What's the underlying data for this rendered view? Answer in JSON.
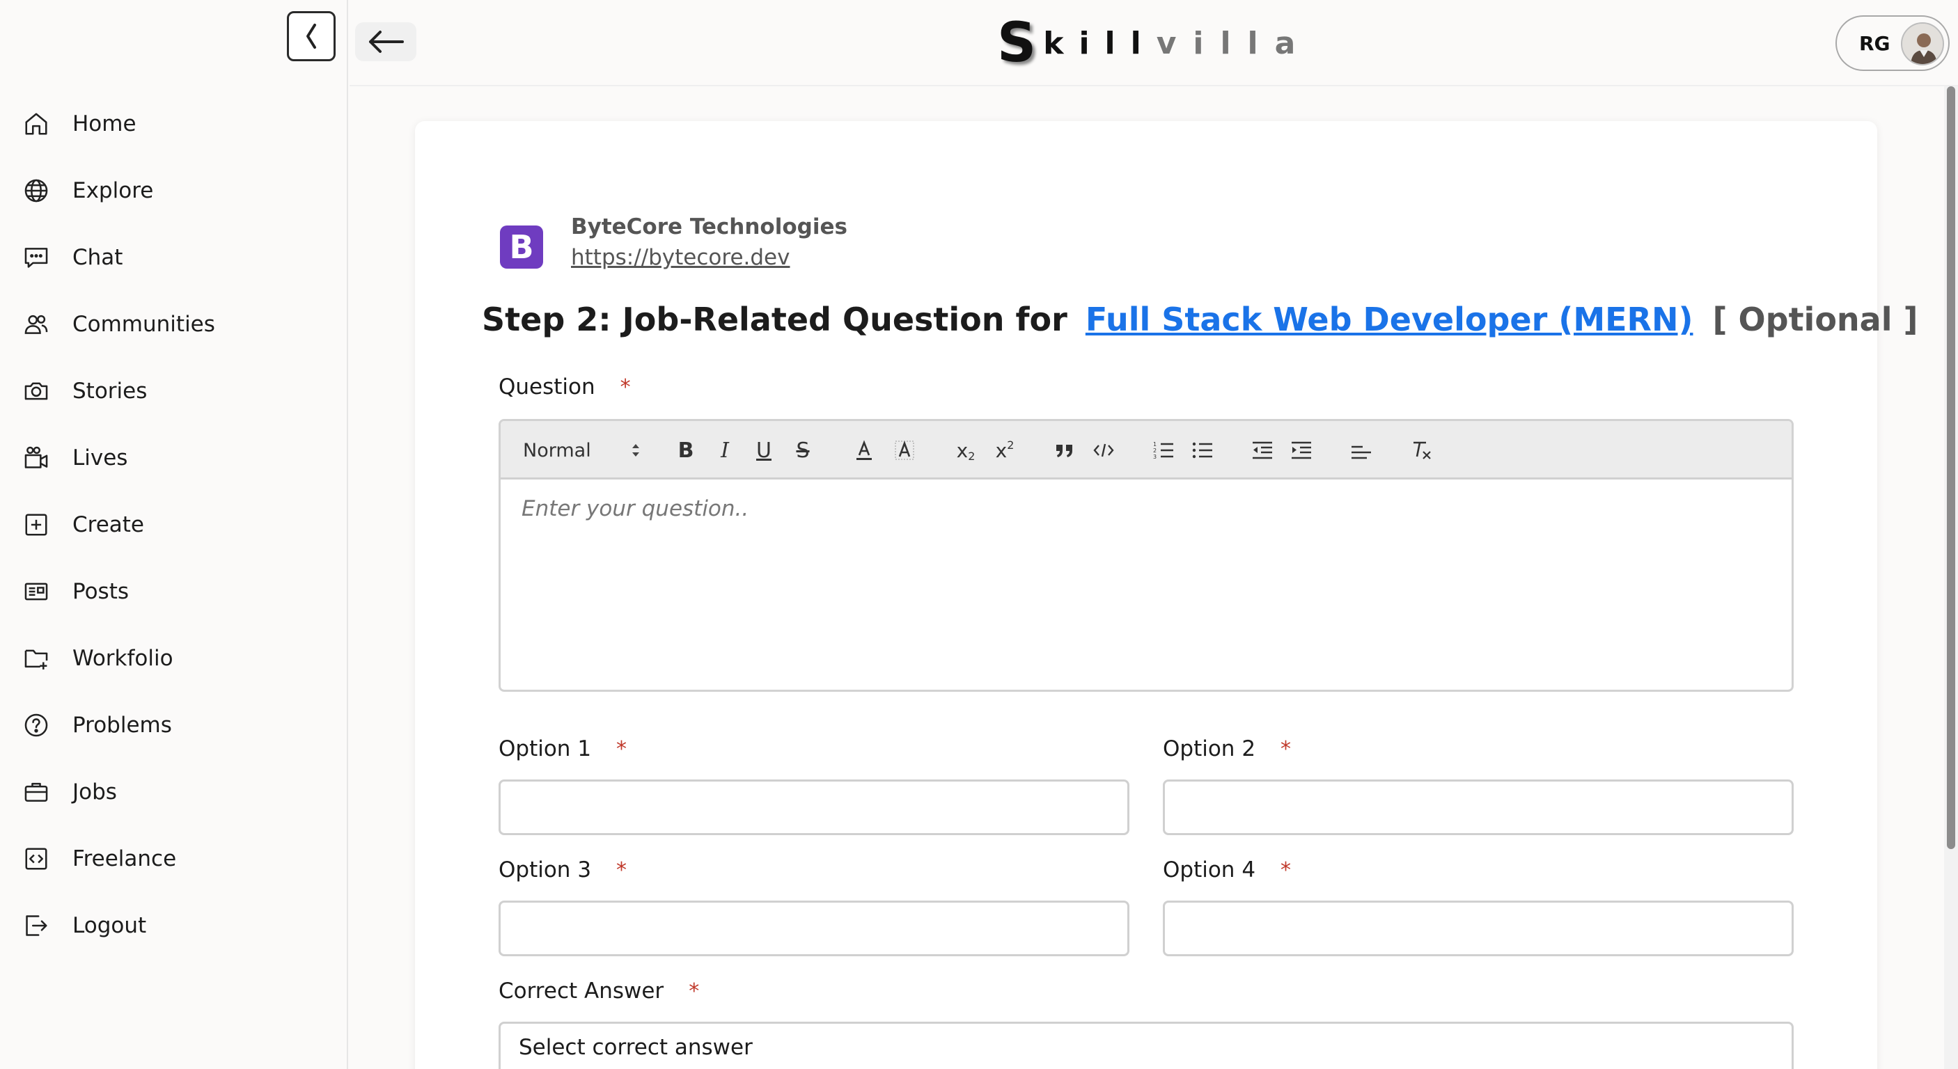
{
  "sidebar": {
    "items": [
      {
        "label": "Home",
        "icon": "home-icon"
      },
      {
        "label": "Explore",
        "icon": "globe-icon"
      },
      {
        "label": "Chat",
        "icon": "chat-icon"
      },
      {
        "label": "Communities",
        "icon": "users-icon"
      },
      {
        "label": "Stories",
        "icon": "camera-icon"
      },
      {
        "label": "Lives",
        "icon": "video-icon"
      },
      {
        "label": "Create",
        "icon": "plus-square-icon"
      },
      {
        "label": "Posts",
        "icon": "newspaper-icon"
      },
      {
        "label": "Workfolio",
        "icon": "folder-plus-icon"
      },
      {
        "label": "Problems",
        "icon": "help-circle-icon"
      },
      {
        "label": "Jobs",
        "icon": "briefcase-icon"
      },
      {
        "label": "Freelance",
        "icon": "code-icon"
      },
      {
        "label": "Logout",
        "icon": "logout-icon"
      }
    ]
  },
  "header": {
    "logo_part1": "S",
    "logo_part2": "kill",
    "logo_part3": "villa",
    "profile_initials": "RG"
  },
  "company": {
    "logo_letter": "B",
    "name": "ByteCore Technologies",
    "url": "https://bytecore.dev"
  },
  "step": {
    "prefix": "Step 2: Job-Related Question for",
    "job_title": "Full Stack Web Developer (MERN)",
    "optional": "[ Optional ]"
  },
  "form": {
    "question_label": "Question",
    "required_mark": "*",
    "editor": {
      "format_select": "Normal",
      "placeholder": "Enter your question.."
    },
    "option1_label": "Option 1",
    "option2_label": "Option 2",
    "option3_label": "Option 3",
    "option4_label": "Option 4",
    "correct_answer_label": "Correct Answer",
    "correct_answer_value": "Select correct answer"
  },
  "colors": {
    "accent_link": "#1a73e8",
    "required": "#c0392b",
    "company_logo": "#6f3cc0"
  }
}
